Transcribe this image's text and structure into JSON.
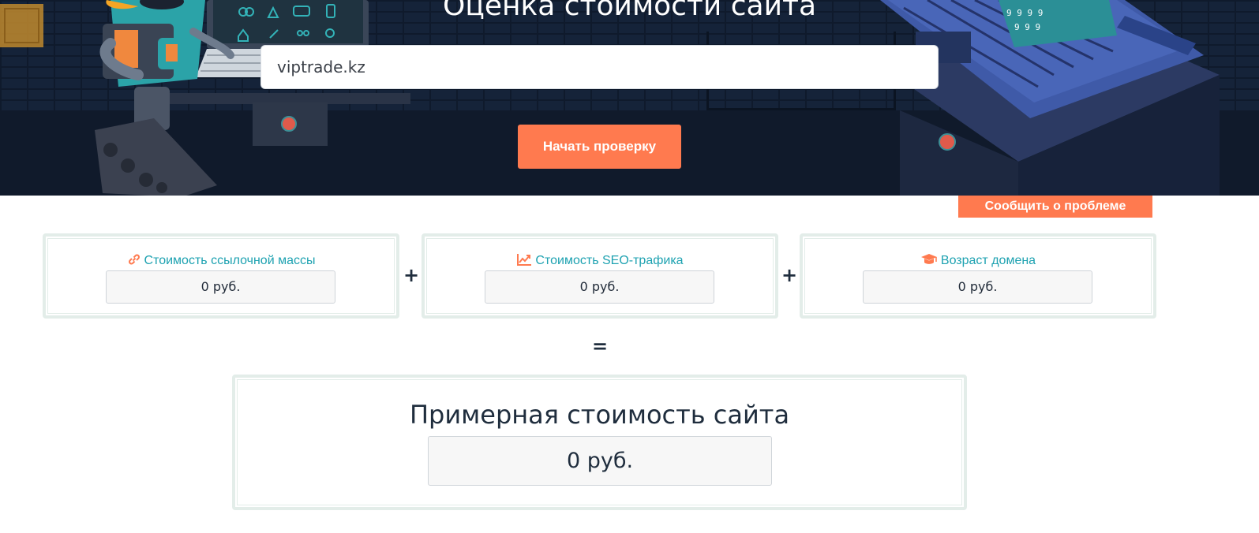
{
  "hero": {
    "title": "Оценка стоимости сайта",
    "url_value": "viptrade.kz",
    "start_button": "Начать проверку"
  },
  "report_button": "Сообщить о проблеме",
  "cards": [
    {
      "icon": "link-icon",
      "title": "Стоимость ссылочной массы",
      "value": "0 руб."
    },
    {
      "icon": "trend-chart-icon",
      "title": "Стоимость SEO-трафика",
      "value": "0 руб."
    },
    {
      "icon": "graduation-cap-icon",
      "title": "Возраст домена",
      "value": "0 руб."
    }
  ],
  "operators": {
    "plus": "+",
    "equals": "="
  },
  "total": {
    "title": "Примерная стоимость сайта",
    "value": "0 руб."
  },
  "colors": {
    "accent": "#ff7a4f",
    "teal": "#1ea2b1",
    "hero_bg": "#0f1a2c",
    "card_border": "#e3ede9"
  }
}
